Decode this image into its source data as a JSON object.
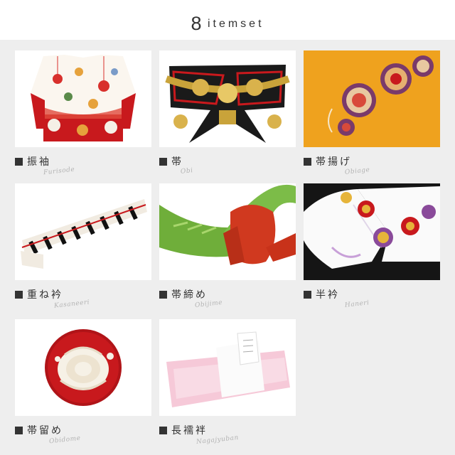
{
  "header": {
    "count": "8",
    "word": "itemset"
  },
  "items": [
    {
      "label": "振袖",
      "romaji": "Furisode"
    },
    {
      "label": "帯",
      "romaji": "Obi"
    },
    {
      "label": "帯揚げ",
      "romaji": "Obiage"
    },
    {
      "label": "重ね衿",
      "romaji": "Kasaneeri"
    },
    {
      "label": "帯締め",
      "romaji": "Obijime"
    },
    {
      "label": "半衿",
      "romaji": "Haneri"
    },
    {
      "label": "帯留め",
      "romaji": "Obidome"
    },
    {
      "label": "長襦袢",
      "romaji": "Nagajyuban"
    }
  ]
}
